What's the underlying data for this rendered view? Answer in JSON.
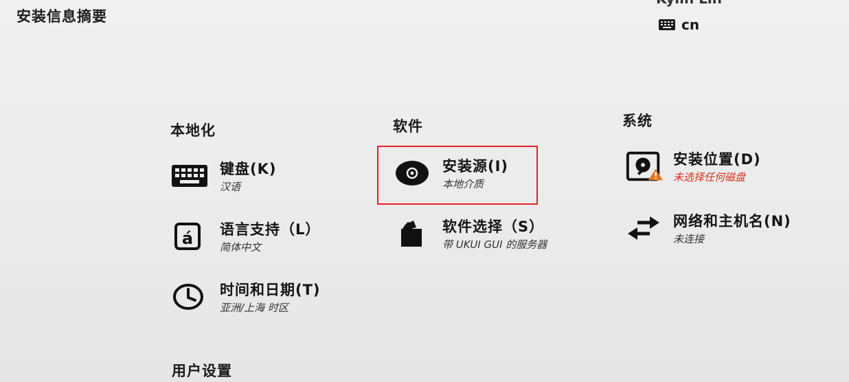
{
  "header": {
    "title": "安装信息摘要",
    "product_name": "Kylin Lin",
    "keyboard_layout": "cn",
    "keyboard_icon": "keyboard-icon"
  },
  "categories": {
    "localization": {
      "title": "本地化",
      "items": [
        {
          "name": "键盘(K)",
          "status": "汉语",
          "icon": "keyboard-icon"
        },
        {
          "name": "语言支持（L）",
          "status": "简体中文",
          "icon": "language-icon"
        },
        {
          "name": "时间和日期(T)",
          "status": "亚洲/上海 时区",
          "icon": "clock-icon"
        }
      ]
    },
    "software": {
      "title": "软件",
      "items": [
        {
          "name": "安装源(I)",
          "status": "本地介质",
          "icon": "disc-icon"
        },
        {
          "name": "软件选择（S）",
          "status": "带 UKUI GUI 的服务器",
          "icon": "package-icon"
        }
      ]
    },
    "system": {
      "title": "系统",
      "items": [
        {
          "name": "安装位置(D)",
          "status": "未选择任何磁盘",
          "icon": "harddisk-warning-icon"
        },
        {
          "name": "网络和主机名(N)",
          "status": "未连接",
          "icon": "network-arrows-icon"
        }
      ]
    },
    "user_settings": {
      "title": "用户设置"
    }
  },
  "colors": {
    "background": "#ececec",
    "text": "#141414",
    "warning": "#d8301f",
    "warning_badge": "#e8731c",
    "highlight": "#e3202a"
  }
}
